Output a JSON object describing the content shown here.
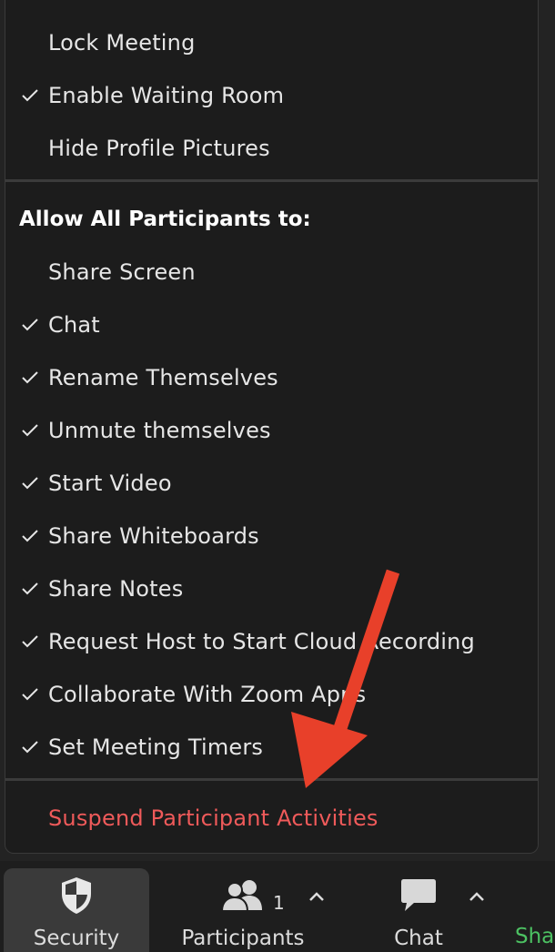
{
  "menu": {
    "top_items": [
      {
        "label": "Lock Meeting",
        "checked": false
      },
      {
        "label": "Enable Waiting Room",
        "checked": true
      },
      {
        "label": "Hide Profile Pictures",
        "checked": false
      }
    ],
    "section_title": "Allow All Participants to:",
    "participant_items": [
      {
        "label": "Share Screen",
        "checked": false
      },
      {
        "label": "Chat",
        "checked": true
      },
      {
        "label": "Rename Themselves",
        "checked": true
      },
      {
        "label": "Unmute themselves",
        "checked": true
      },
      {
        "label": "Start Video",
        "checked": true
      },
      {
        "label": "Share Whiteboards",
        "checked": true
      },
      {
        "label": "Share Notes",
        "checked": true
      },
      {
        "label": "Request Host to Start Cloud Recording",
        "checked": true
      },
      {
        "label": "Collaborate With Zoom Apps",
        "checked": true
      },
      {
        "label": "Set Meeting Timers",
        "checked": true
      }
    ],
    "suspend_label": "Suspend Participant Activities"
  },
  "toolbar": {
    "security_label": "Security",
    "participants_label": "Participants",
    "participants_count": "1",
    "chat_label": "Chat",
    "share_label": "Sha"
  },
  "colors": {
    "menu_bg": "#1c1c1c",
    "text": "#e6e6e6",
    "danger": "#ef5a5a",
    "arrow": "#e8402a",
    "share_green": "#4cc162"
  }
}
